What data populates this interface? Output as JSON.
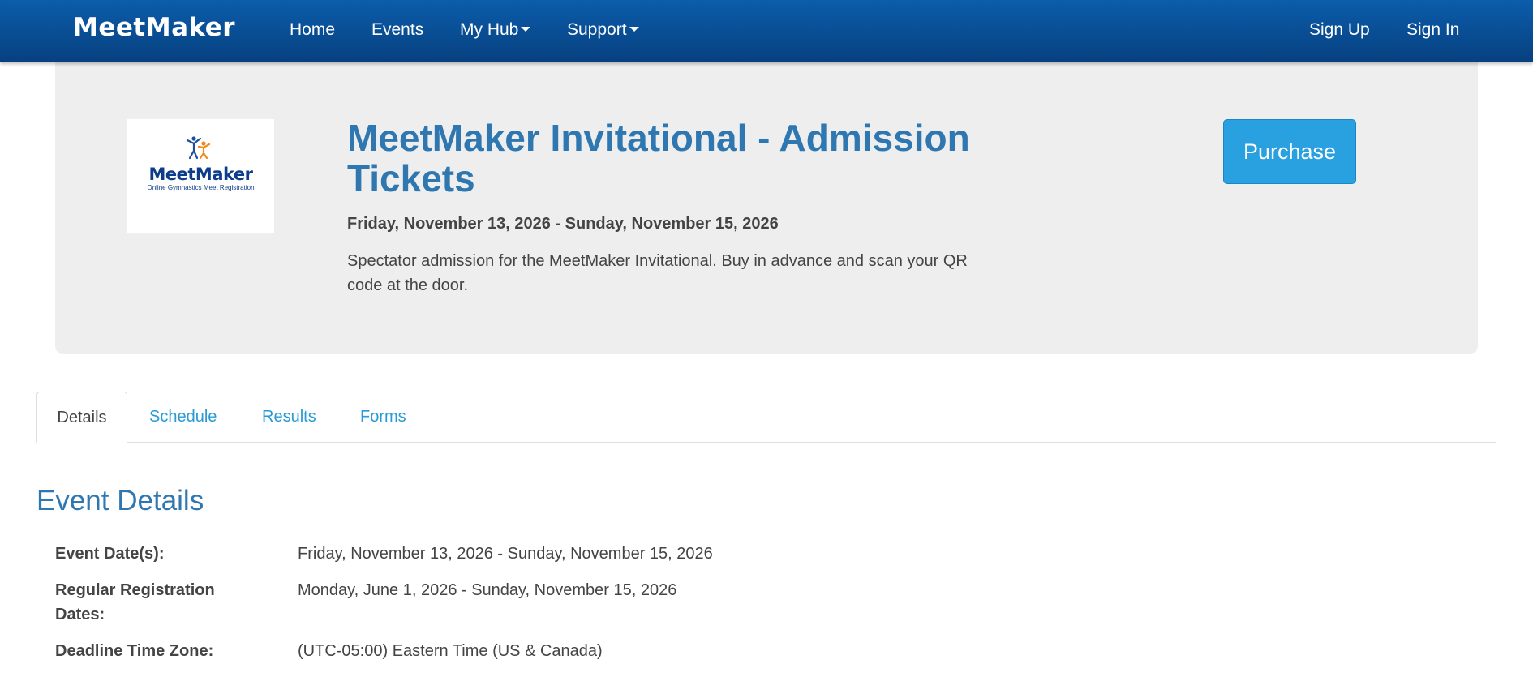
{
  "navbar": {
    "brand": "MeetMaker",
    "links": {
      "home": "Home",
      "events": "Events",
      "my_hub": "My Hub",
      "support": "Support",
      "sign_up": "Sign Up",
      "sign_in": "Sign In"
    }
  },
  "hero": {
    "logo": {
      "name": "MeetMaker",
      "tagline": "Online Gymnastics Meet Registration"
    },
    "title": "MeetMaker Invitational - Admission Tickets",
    "dates": "Friday, November 13, 2026 - Sunday, November 15, 2026",
    "description": "Spectator admission for the MeetMaker Invitational. Buy in advance and scan your QR code at the door.",
    "purchase_label": "Purchase"
  },
  "tabs": [
    {
      "label": "Details",
      "active": true
    },
    {
      "label": "Schedule",
      "active": false
    },
    {
      "label": "Results",
      "active": false
    },
    {
      "label": "Forms",
      "active": false
    }
  ],
  "details": {
    "heading": "Event Details",
    "rows": [
      {
        "label": "Event Date(s):",
        "value": "Friday, November 13, 2026 - Sunday, November 15, 2026"
      },
      {
        "label": "Regular Registration Dates:",
        "value": "Monday, June 1, 2026 - Sunday, November 15, 2026"
      },
      {
        "label": "Deadline Time Zone:",
        "value": "(UTC-05:00) Eastern Time (US & Canada)"
      }
    ]
  },
  "colors": {
    "nav_top": "#0b5dab",
    "nav_bottom": "#07407f",
    "title_blue": "#2f77b0",
    "link_blue": "#2a9ad6",
    "purchase_button": "#29a0e0",
    "hero_background": "#eeeeee"
  }
}
